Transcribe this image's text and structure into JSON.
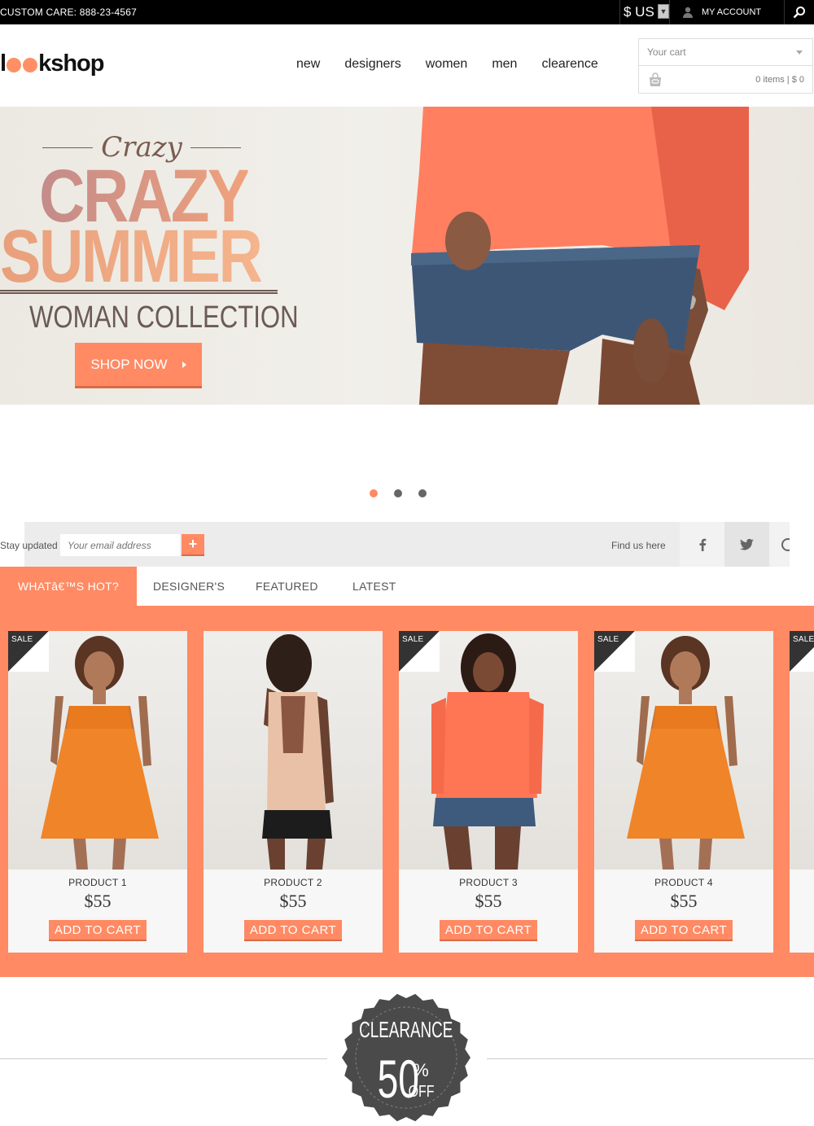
{
  "topbar": {
    "custom_care": "CUSTOM CARE: 888-23-4567",
    "currency": "$ US",
    "my_account": "MY ACCOUNT"
  },
  "brand": {
    "logo_pre": "l",
    "logo_post": "kshop",
    "accent": "#ff8a63"
  },
  "nav": [
    "new",
    "designers",
    "women",
    "men",
    "clearence"
  ],
  "cart": {
    "title": "Your cart",
    "summary": "0 items | $ 0"
  },
  "hero": {
    "script": "Crazy",
    "line1": "CRAZY",
    "line2": "SUMMER",
    "subtitle": "WOMAN COLLECTION",
    "cta": "SHOP NOW"
  },
  "slider": {
    "count": 3,
    "active": 0
  },
  "newsletter": {
    "label": "Stay updated",
    "placeholder": "Your email address",
    "find_us": "Find us here"
  },
  "tabs": [
    "WHATâ€™S HOT?",
    "DESIGNER'S",
    "FEATURED",
    "LATEST"
  ],
  "products": [
    {
      "name": "PRODUCT 1",
      "price": "$55",
      "sale": "SALE",
      "cta": "ADD TO CART",
      "dress": "orange-dress"
    },
    {
      "name": "PRODUCT 2",
      "price": "$55",
      "sale": "",
      "cta": "ADD TO CART",
      "dress": "tank-shorts"
    },
    {
      "name": "PRODUCT 3",
      "price": "$55",
      "sale": "SALE",
      "cta": "ADD TO CART",
      "dress": "coral-top"
    },
    {
      "name": "PRODUCT 4",
      "price": "$55",
      "sale": "SALE",
      "cta": "ADD TO CART",
      "dress": "orange-dress"
    },
    {
      "name": "",
      "price": "",
      "sale": "SALE",
      "cta": "",
      "dress": ""
    }
  ],
  "clearance": {
    "line1": "CLEARANCE",
    "percent": "50",
    "pct_sign": "%",
    "off": "OFF"
  }
}
